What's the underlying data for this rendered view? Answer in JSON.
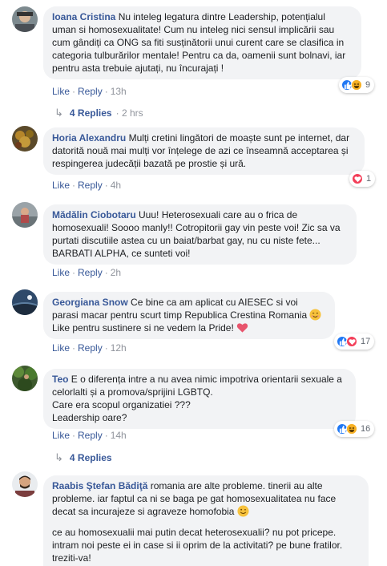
{
  "action_like": "Like",
  "action_reply": "Reply",
  "comments": [
    {
      "name": "Ioana Cristina",
      "text": "Nu inteleg legatura dintre Leadership, potențialul uman si homosexualitate! Cum nu inteleg nici sensul implicării sau cum gândiți ca ONG sa fiti susținătorii unui curent care se clasifica in categoria tulburărilor mentale! Pentru ca da, oamenii sunt bolnavi, iar pentru asta trebuie ajutați, nu încurajați !",
      "time": "13h",
      "reaction_count": "9",
      "replies_label": "4 Replies",
      "replies_time": "2 hrs"
    },
    {
      "name": "Horia Alexandru",
      "text": "Mulți cretini lingători de moaște sunt pe internet, dar datorită nouă mai mulți vor înțelege de azi ce înseamnă acceptarea și respingerea judecății bazată pe prostie și ură.",
      "time": "4h",
      "reaction_count": "1"
    },
    {
      "name": "Mădălin Ciobotaru",
      "text": "Uuu! Heterosexuali care au o frica de homosexuali! Soooo manly!! Cotropitorii gay vin peste voi! Zic sa va purtati discutiile astea cu un baiat/barbat gay, nu cu niste fete... BARBATI ALPHA, ce sunteti voi!",
      "time": "2h"
    },
    {
      "name": "Georgiana Snow",
      "text_1": "Ce bine ca am aplicat cu AIESEC si voi parasi macar pentru scurt timp Republica Crestina Romania",
      "text_2": "Like pentru sustinere si ne vedem la Pride!",
      "time": "12h",
      "reaction_count": "17"
    },
    {
      "name": "Teo",
      "text_1": "E o diferența intre a nu avea nimic impotriva orientarii sexuale a celorlalti și a promova/sprijini LGBTQ.",
      "text_2": "Care era scopul organizatiei ???",
      "text_3": "Leadership oare?",
      "time": "14h",
      "reaction_count": "16",
      "replies_label": "4 Replies"
    },
    {
      "name": "Raabis Ştefan Bădiţă",
      "text_1": "romania are alte probleme. tinerii au alte probleme. iar faptul ca ni se baga pe gat homosexualitatea nu face decat sa incurajeze si agraveze homofobia",
      "text_2": "ce au homosexualii mai putin decat heterosexualii? nu pot pricepe. intram noi peste ei in case si ii oprim de la activitati? pe bune fratilor. treziti-va!"
    }
  ],
  "colors": {
    "link": "#385898",
    "bubble": "#f2f3f5",
    "like_blue": "#2078f4",
    "love_red": "#f33e58",
    "haha_yellow": "#f7b125"
  }
}
